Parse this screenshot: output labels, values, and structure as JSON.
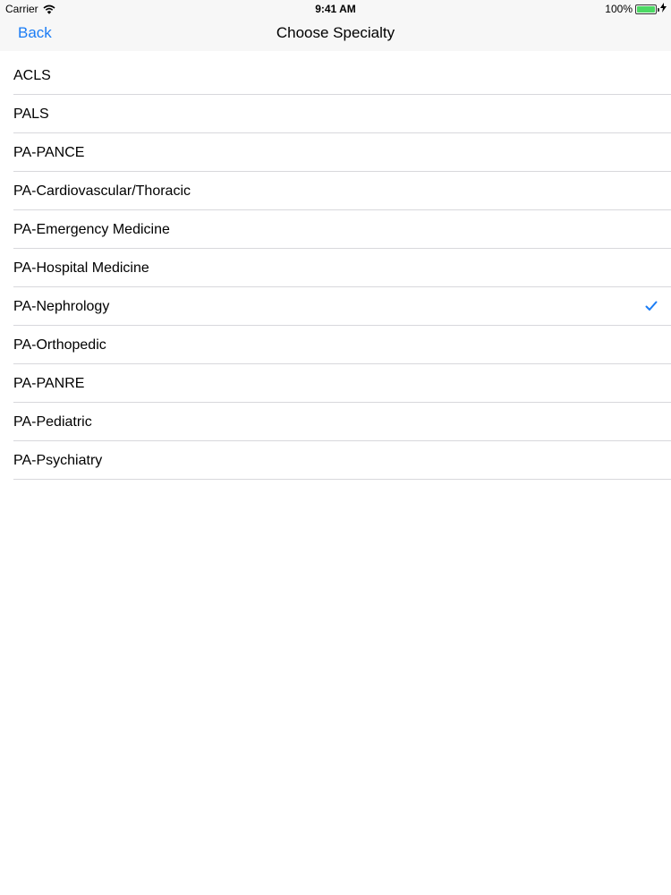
{
  "status_bar": {
    "carrier": "Carrier",
    "wifi_icon": "wifi-icon",
    "time": "9:41 AM",
    "battery_percent": "100%",
    "battery_icon": "battery-icon",
    "battery_level": 1.0,
    "charging_icon": "bolt-icon"
  },
  "nav": {
    "back_label": "Back",
    "title": "Choose Specialty"
  },
  "accent_color": "#1a7cf5",
  "specialties": [
    {
      "label": "ACLS",
      "selected": false
    },
    {
      "label": "PALS",
      "selected": false
    },
    {
      "label": "PA-PANCE",
      "selected": false
    },
    {
      "label": "PA-Cardiovascular/Thoracic",
      "selected": false
    },
    {
      "label": "PA-Emergency Medicine",
      "selected": false
    },
    {
      "label": "PA-Hospital Medicine",
      "selected": false
    },
    {
      "label": "PA-Nephrology",
      "selected": true
    },
    {
      "label": "PA-Orthopedic",
      "selected": false
    },
    {
      "label": "PA-PANRE",
      "selected": false
    },
    {
      "label": "PA-Pediatric",
      "selected": false
    },
    {
      "label": "PA-Psychiatry",
      "selected": false
    }
  ]
}
